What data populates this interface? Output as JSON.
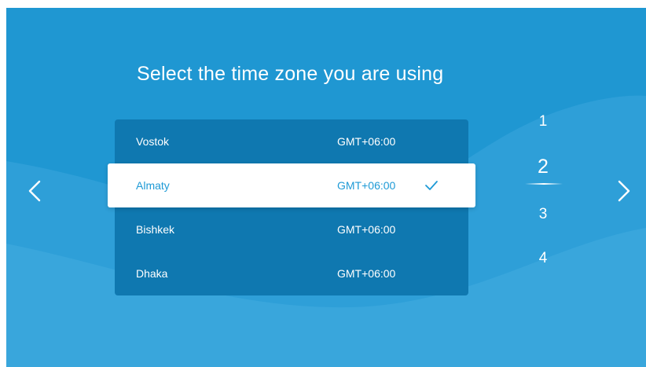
{
  "title": "Select the time zone you are using",
  "timezones": [
    {
      "city": "Vostok",
      "offset": "GMT+06:00",
      "selected": false
    },
    {
      "city": "Almaty",
      "offset": "GMT+06:00",
      "selected": true
    },
    {
      "city": "Bishkek",
      "offset": "GMT+06:00",
      "selected": false
    },
    {
      "city": "Dhaka",
      "offset": "GMT+06:00",
      "selected": false
    }
  ],
  "pages": [
    "1",
    "2",
    "3",
    "4"
  ],
  "current_page": "2",
  "icons": {
    "prev": "chevron-left-icon",
    "next": "chevron-right-icon",
    "selected": "checkmark-icon"
  },
  "colors": {
    "background": "#1f97d2",
    "panel": "#0f78b0",
    "selected_row": "#ffffff",
    "selected_text": "#1e9ad6"
  }
}
